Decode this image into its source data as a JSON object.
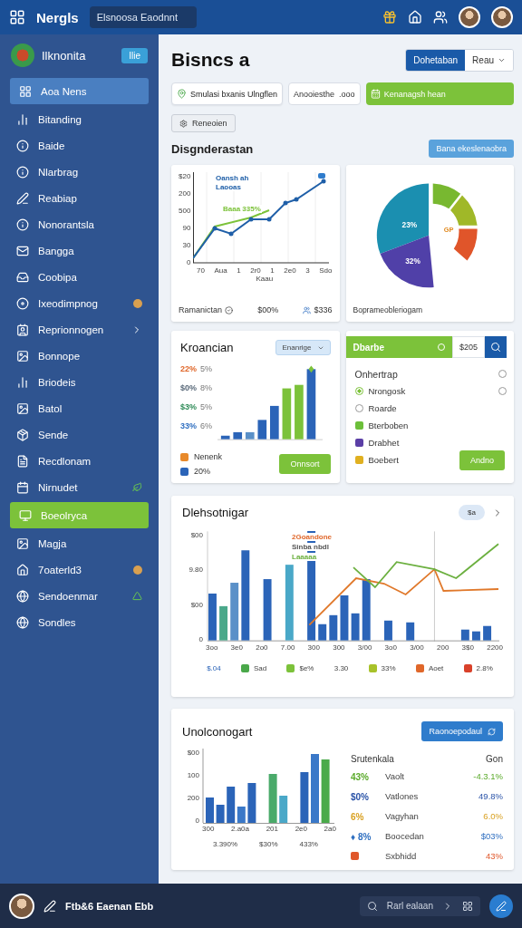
{
  "topbar": {
    "brand": "Nergls",
    "search": {
      "value": "Elsnoosa Eaodnnt"
    }
  },
  "sidebar": {
    "profile": {
      "name": "Ilknonita",
      "badge": "Ilie"
    },
    "items": [
      {
        "label": "Aoa Nens",
        "selected": true,
        "color": "#4a7fc1",
        "kind": "plain"
      },
      {
        "label": "Bitanding",
        "selected": false,
        "kind": "plain"
      },
      {
        "label": "Baide",
        "selected": false,
        "kind": "plain"
      },
      {
        "label": "Nlarbrag",
        "selected": false,
        "kind": "plain"
      },
      {
        "label": "Reabiap",
        "selected": false,
        "kind": "plain"
      },
      {
        "label": "Nonorantsla",
        "selected": false,
        "kind": "plain"
      },
      {
        "label": "Bangga",
        "selected": false,
        "kind": "plain"
      },
      {
        "label": "Coobipa",
        "selected": false,
        "kind": "plain"
      },
      {
        "label": "Ixeodimpnog",
        "selected": false,
        "kind": "coin"
      },
      {
        "label": "Reprionnogen",
        "selected": false,
        "kind": "submenu"
      },
      {
        "label": "Bonnope",
        "selected": false,
        "kind": "plain"
      },
      {
        "label": "Briodeis",
        "selected": false,
        "kind": "plain"
      },
      {
        "label": "Batol",
        "selected": false,
        "kind": "plain"
      },
      {
        "label": "Sende",
        "selected": false,
        "kind": "plain"
      },
      {
        "label": "Recdlonam",
        "selected": false,
        "kind": "plain"
      },
      {
        "label": "Nirnudet",
        "selected": false,
        "kind": "leaf"
      },
      {
        "label": "Boeolryca",
        "selected": true,
        "color": "#7cc23a",
        "kind": "plain"
      },
      {
        "label": "Magja",
        "selected": false,
        "kind": "plain"
      },
      {
        "label": "7oaterld3",
        "selected": false,
        "kind": "coin"
      },
      {
        "label": "Sendoenmar",
        "selected": false,
        "kind": "triangle"
      },
      {
        "label": "Sondles",
        "selected": false,
        "kind": "plain"
      }
    ]
  },
  "header": {
    "title": "Bisncs a",
    "segment_button": {
      "label": "Dohetaban",
      "selected": true
    },
    "period_dropdown": {
      "value": "Reau"
    }
  },
  "actions": {
    "primary": {
      "label": "Smulasi bxanis Ulngflen"
    },
    "field": {
      "value": "Anooiesthe",
      "suffix": ".ooo"
    },
    "cta": {
      "label": "Kenanagsh hean"
    },
    "small": {
      "label": "Reneoien"
    }
  },
  "section": {
    "title": "Disgnderastan",
    "button": "Bana ekeslenaobra"
  },
  "trend_card": {
    "legend": [
      "Oansh ah",
      "Laooas"
    ],
    "annotation": "Baaa 335%",
    "yticks": [
      "$20",
      "200",
      "500",
      "90",
      "30",
      "0"
    ],
    "xticks": [
      "70",
      "Aua",
      "1",
      "2r0",
      "1",
      "2e0",
      "3",
      "Sdo"
    ],
    "xlabel": "Kaau",
    "footer": {
      "label": "Ramanictan",
      "value": "$00%",
      "change": "$336"
    }
  },
  "share_card": {
    "labels": [
      "23%",
      "32%",
      "GP"
    ],
    "caption": "Boprameobleriogam"
  },
  "growth_card": {
    "title": "Kroancian",
    "dropdown": "Enanrige",
    "rows": [
      {
        "value": "22%",
        "delta": "5%",
        "color": "#e0672a"
      },
      {
        "value": "$0%",
        "delta": "8%",
        "color": "#5a6a7a"
      },
      {
        "value": "$3%",
        "delta": "5%",
        "color": "#2e8b57"
      },
      {
        "value": "33%",
        "delta": "6%",
        "color": "#2f6fc0"
      }
    ],
    "legend": [
      {
        "label": "Nenenk",
        "color": "#e8892a"
      },
      {
        "label": "20%",
        "color": "#2b64b8"
      }
    ],
    "button": "Onnsort"
  },
  "filter_card": {
    "search": {
      "value": "Dbarbe",
      "amount": "$205"
    },
    "options": [
      {
        "label": "Onhertrap",
        "kind": "heading",
        "toggle": false
      },
      {
        "label": "Nrongosk",
        "kind": "radio",
        "checked": true,
        "toggle": false
      },
      {
        "label": "Roarde",
        "kind": "radio",
        "checked": false
      },
      {
        "label": "Bterboben",
        "kind": "swatch",
        "color": "#6cbf3a"
      },
      {
        "label": "Drabhet",
        "kind": "swatch",
        "color": "#5b3fa6"
      },
      {
        "label": "Boebert",
        "kind": "swatch",
        "color": "#e0b020"
      }
    ],
    "button": "Andno"
  },
  "combo_card": {
    "title": "Dlehsotnigar",
    "pill": "$a",
    "yticks": [
      "$00",
      "9.80",
      "$00",
      "0"
    ],
    "xticks": [
      "3oo",
      "3e0",
      "2o0",
      "7.00",
      "300",
      "300",
      "3/00",
      "3o0",
      "3/00",
      "200",
      "3$0",
      "2200"
    ],
    "annotations": [
      "2Goandone",
      "Sinba nbdl",
      "Laaaaa"
    ],
    "legend": [
      {
        "label": "$.04"
      },
      {
        "label": "Sad",
        "color": "#4aa84a"
      },
      {
        "label": "$e%",
        "color": "#7cc23a"
      },
      {
        "label": "3.30"
      },
      {
        "label": "33%",
        "color": "#a8c22a"
      },
      {
        "label": "Aoet",
        "color": "#e0672a"
      },
      {
        "label": "2.8%",
        "color": "#d9412a"
      }
    ]
  },
  "units_card": {
    "title": "Unolconogart",
    "button": "Raonoepodaul",
    "yticks": [
      "$00",
      "100",
      "200",
      "0"
    ],
    "xticks": [
      "300",
      "2.a0a",
      "201",
      "2e0",
      "2a0"
    ],
    "totals": [
      "3.390%",
      "$30%",
      "433%"
    ],
    "table": {
      "header": [
        "Srutenkala",
        "Gon"
      ],
      "rows": [
        {
          "kind": "value",
          "value": "43%",
          "label": "Vaolt",
          "change": "-4.3.1%",
          "color": "#5aaa2a"
        },
        {
          "kind": "value",
          "value": "$0%",
          "label": "Vatlones",
          "change": "49.8%",
          "color": "#2b54a8"
        },
        {
          "kind": "value",
          "value": "6%",
          "label": "Vagyhan",
          "change": "6.0%",
          "color": "#d9a020"
        },
        {
          "kind": "value",
          "value": "♦ 8%",
          "label": "Boocedan",
          "change": "$03%",
          "color": "#2f6fc0"
        },
        {
          "kind": "swatch",
          "label": "Sxbhidd",
          "change": "43%",
          "color": "#e0572a"
        }
      ]
    }
  },
  "bottombar": {
    "title": "Ftb&6 Eaenan Ebb",
    "search": "Rarl ealaan"
  }
}
